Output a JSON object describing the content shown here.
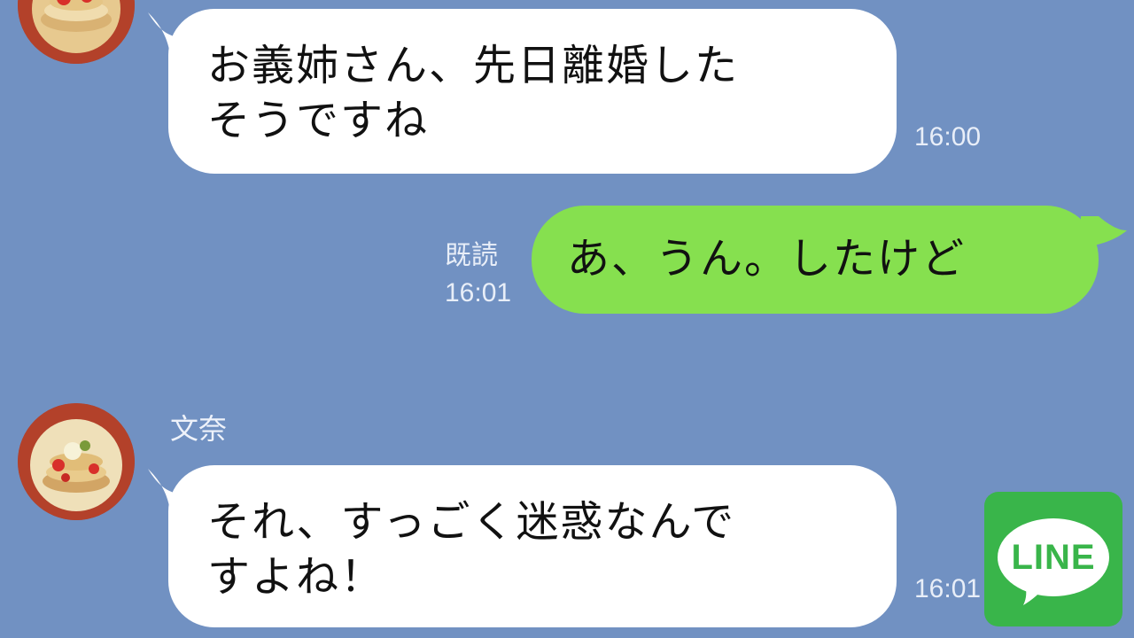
{
  "chat": {
    "messages": [
      {
        "side": "left",
        "lines": [
          "お義姉さん、先日離婚した",
          "そうですね"
        ],
        "time": "16:00"
      },
      {
        "side": "right",
        "text": "あ、うん。したけど",
        "read_label": "既読",
        "time": "16:01"
      },
      {
        "side": "left",
        "sender": "文奈",
        "lines": [
          "それ、すっごく迷惑なんで",
          "すよね！"
        ],
        "time": "16:01"
      }
    ]
  },
  "logo": {
    "text": "LINE",
    "color": "#39b54a"
  },
  "colors": {
    "background": "#7191c2",
    "incoming_bubble": "#ffffff",
    "outgoing_bubble": "#86e04f"
  },
  "icons": [
    "avatar-photo",
    "line-logo-icon"
  ]
}
